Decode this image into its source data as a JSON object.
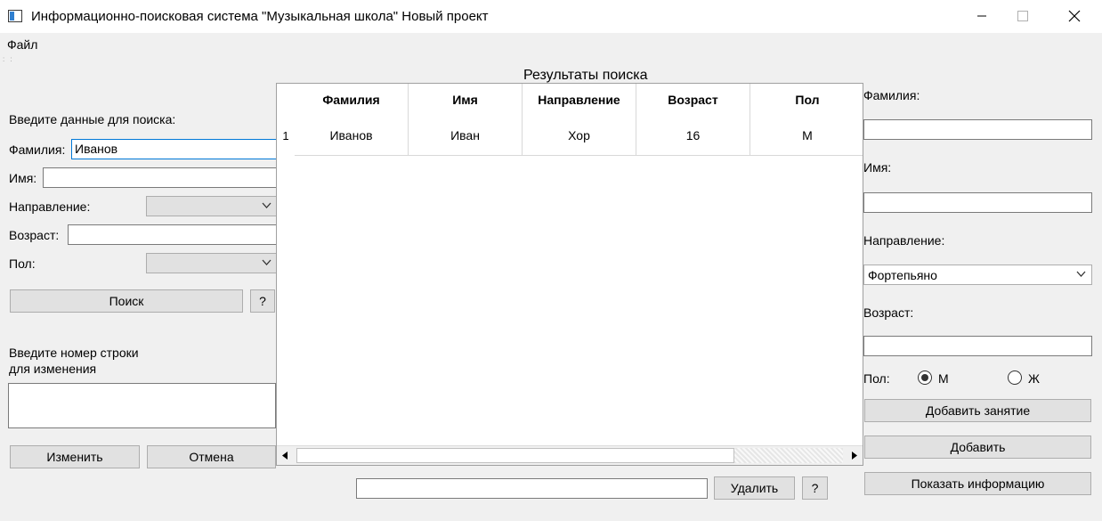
{
  "window": {
    "title": "Информационно-поисковая система \"Музыкальная школа\" Новый проект",
    "icon": "app-window-icon"
  },
  "menu": {
    "file": "Файл"
  },
  "search": {
    "header": "Введите данные для поиска:",
    "surname_label": "Фамилия:",
    "surname_value": "Иванов",
    "name_label": "Имя:",
    "name_value": "",
    "direction_label": "Направление:",
    "direction_value": "",
    "age_label": "Возраст:",
    "age_value": "",
    "gender_label": "Пол:",
    "gender_value": "",
    "search_button": "Поиск",
    "help_button": "?"
  },
  "edit": {
    "prompt": "Введите номер строки",
    "prompt2": "для изменения",
    "change_button": "Изменить",
    "cancel_button": "Отмена"
  },
  "results": {
    "title": "Результаты поиска",
    "columns": [
      "Фамилия",
      "Имя",
      "Направление",
      "Возраст",
      "Пол"
    ],
    "rows": [
      {
        "num": "1",
        "cells": [
          "Иванов",
          "Иван",
          "Хор",
          "16",
          "М"
        ]
      }
    ],
    "delete_input": "",
    "delete_button": "Удалить",
    "help_button": "?"
  },
  "add": {
    "surname_label": "Фамилия:",
    "surname_value": "",
    "name_label": "Имя:",
    "name_value": "",
    "direction_label": "Направление:",
    "direction_value": "Фортепьяно",
    "age_label": "Возраст:",
    "age_value": "",
    "gender_label": "Пол:",
    "gender_m": "М",
    "gender_f": "Ж",
    "gender_selected": "М",
    "add_lesson_button": "Добавить занятие",
    "add_button": "Добавить",
    "show_info_button": "Показать информацию"
  }
}
